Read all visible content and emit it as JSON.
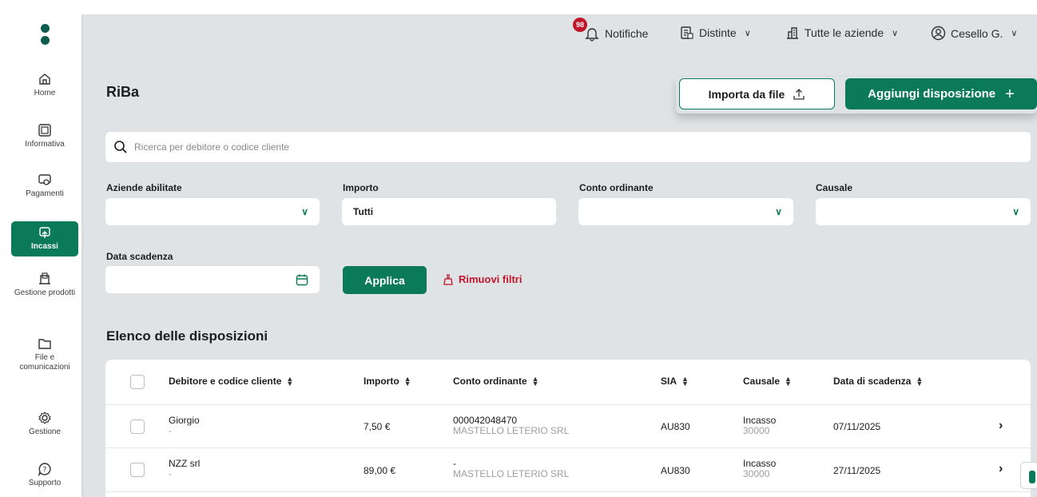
{
  "sidebar": {
    "items": [
      {
        "label": "Home",
        "icon": "home-icon"
      },
      {
        "label": "Informativa",
        "icon": "info-card-icon"
      },
      {
        "label": "Pagamenti",
        "icon": "payments-icon"
      },
      {
        "label": "Incassi",
        "icon": "collections-icon",
        "active": true
      },
      {
        "label": "Gestione prodotti",
        "icon": "products-icon"
      },
      {
        "label": "File e comunicazioni",
        "icon": "folder-icon"
      },
      {
        "label": "Gestione",
        "icon": "gear-icon"
      },
      {
        "label": "Supporto",
        "icon": "help-icon"
      }
    ]
  },
  "topbar": {
    "notifications_label": "Notifiche",
    "notifications_count": "98",
    "distinte_label": "Distinte",
    "companies_label": "Tutte le aziende",
    "user_label": "Cesello G."
  },
  "page": {
    "title": "RiBa",
    "import_button": "Importa da file",
    "add_button": "Aggiungi disposizione"
  },
  "filters": {
    "search_placeholder": "Ricerca per debitore o codice cliente",
    "aziende_label": "Aziende abilitate",
    "aziende_value": "",
    "importo_label": "Importo",
    "importo_value": "Tutti",
    "conto_label": "Conto ordinante",
    "conto_value": "",
    "causale_label": "Causale",
    "causale_value": "",
    "data_label": "Data scadenza",
    "data_value": "",
    "apply_button": "Applica",
    "remove_button": "Rimuovi filtri"
  },
  "table": {
    "title": "Elenco delle disposizioni",
    "columns": [
      "Debitore e codice cliente",
      "Importo",
      "Conto ordinante",
      "SIA",
      "Causale",
      "Data di scadenza"
    ],
    "rows": [
      {
        "debitore": "Giorgio",
        "codice": "-",
        "importo": "7,50 €",
        "conto": "000042048470",
        "conto_sub": "MASTELLO LETERIO SRL",
        "sia": "AU830",
        "causale": "Incasso",
        "causale_sub": "30000",
        "data": "07/11/2025"
      },
      {
        "debitore": "NZZ srl",
        "codice": "-",
        "importo": "89,00 €",
        "conto": "-",
        "conto_sub": "MASTELLO LETERIO SRL",
        "sia": "AU830",
        "causale": "Incasso",
        "causale_sub": "30000",
        "data": "27/11/2025"
      }
    ]
  },
  "colors": {
    "primary": "#0b7a58",
    "danger": "#c0162c",
    "background": "#dfe3e5"
  }
}
